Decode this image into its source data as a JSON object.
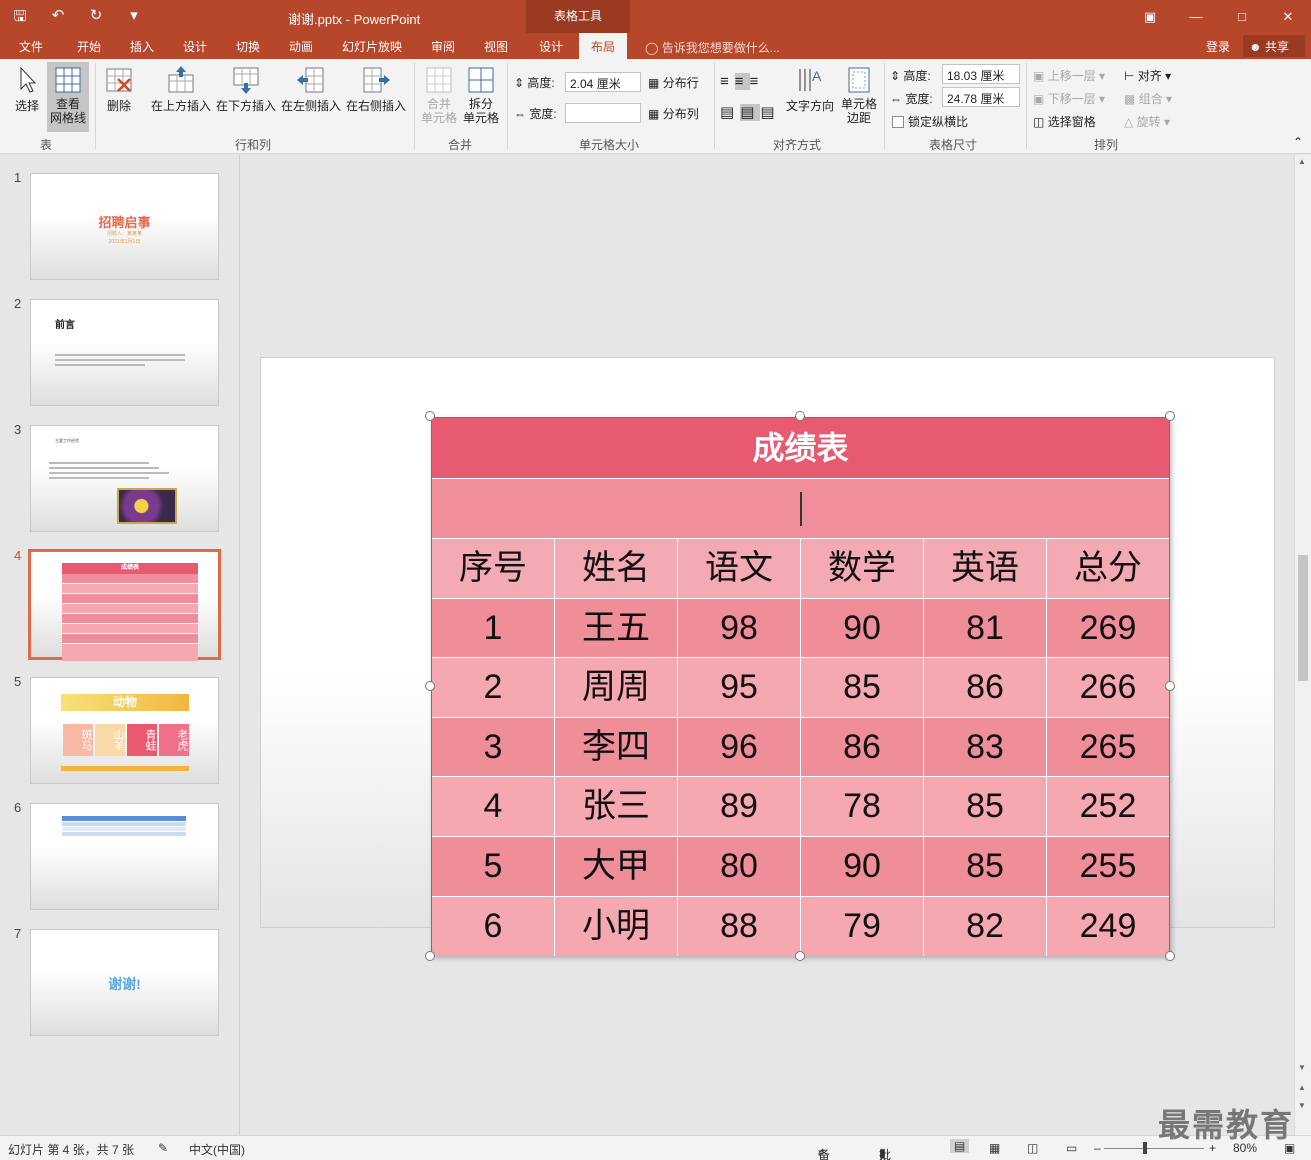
{
  "window": {
    "doc_title": "谢谢.pptx - PowerPoint",
    "context_tab_group": "表格工具",
    "qat_icons": [
      "save-icon",
      "undo-icon",
      "redo-icon",
      "customize-icon"
    ],
    "controls": [
      "minimize",
      "restore",
      "close"
    ]
  },
  "tabs": {
    "file": "文件",
    "home": "开始",
    "insert": "插入",
    "design": "设计",
    "transitions": "切换",
    "animations": "动画",
    "slideshow": "幻灯片放映",
    "review": "审阅",
    "view": "视图",
    "table_design": "设计",
    "layout": "布局"
  },
  "tellme": "告诉我您想要做什么...",
  "account": {
    "login": "登录",
    "share": "共享"
  },
  "ribbon": {
    "select": "选择",
    "view_gridlines": "查看\n网格线",
    "group_table": "表",
    "delete": "删除",
    "insert_above": "在上方插入",
    "insert_below": "在下方插入",
    "insert_left": "在左侧插入",
    "insert_right": "在右侧插入",
    "group_rows_cols": "行和列",
    "merge_cells": "合并\n单元格",
    "split_cells": "拆分\n单元格",
    "group_merge": "合并",
    "height_label": "高度:",
    "height_value": "2.04 厘米",
    "width_label": "宽度:",
    "width_value": "",
    "distribute_rows": "分布行",
    "distribute_cols": "分布列",
    "group_cell_size": "单元格大小",
    "text_direction": "文字方向",
    "cell_margins": "单元格\n边距",
    "group_alignment": "对齐方式",
    "table_height_label": "高度:",
    "table_height_value": "18.03 厘米",
    "table_width_label": "宽度:",
    "table_width_value": "24.78 厘米",
    "lock_aspect": "锁定纵横比",
    "group_table_size": "表格尺寸",
    "bring_forward": "上移一层",
    "send_backward": "下移一层",
    "selection_pane": "选择窗格",
    "align": "对齐",
    "group": "组合",
    "rotate": "旋转",
    "group_arrange": "排列"
  },
  "thumbnails": [
    {
      "num": "1",
      "title": "招聘启事",
      "line1": "招聘人：某某某",
      "line2": "2021年1月1日"
    },
    {
      "num": "2",
      "title": "前言"
    },
    {
      "num": "3",
      "title": "主要工作经验"
    },
    {
      "num": "4",
      "title": "成绩表"
    },
    {
      "num": "5",
      "title": "动物",
      "cells": [
        "斑马",
        "山羊",
        "青蛙",
        "老虎"
      ]
    },
    {
      "num": "6"
    },
    {
      "num": "7",
      "title": "谢谢!"
    }
  ],
  "table": {
    "title": "成绩表",
    "headers": [
      "序号",
      "姓名",
      "语文",
      "数学",
      "英语",
      "总分"
    ],
    "rows": [
      [
        "1",
        "王五",
        "98",
        "90",
        "81",
        "269"
      ],
      [
        "2",
        "周周",
        "95",
        "85",
        "86",
        "266"
      ],
      [
        "3",
        "李四",
        "96",
        "86",
        "83",
        "265"
      ],
      [
        "4",
        "张三",
        "89",
        "78",
        "85",
        "252"
      ],
      [
        "5",
        "大甲",
        "80",
        "90",
        "85",
        "255"
      ],
      [
        "6",
        "小明",
        "88",
        "79",
        "82",
        "249"
      ]
    ]
  },
  "status": {
    "slide_info": "幻灯片 第 4 张，共 7 张",
    "language": "中文(中国)",
    "notes": "备注",
    "comments": "批注",
    "zoom": "80%"
  },
  "watermark": "最需教育"
}
